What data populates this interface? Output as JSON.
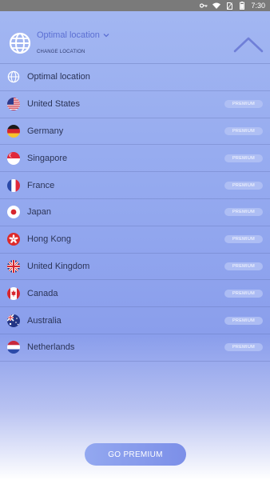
{
  "status_bar": {
    "time": "7:30",
    "icons": [
      "key-icon",
      "wifi-icon",
      "no-sim-icon",
      "battery-icon"
    ]
  },
  "header": {
    "title": "Optimal location",
    "subtitle": "CHANGE LOCATION",
    "icon": "globe-icon",
    "dropdown_icon": "chevron-down-icon",
    "collapse_icon": "chevron-up-icon"
  },
  "locations": [
    {
      "name": "Optimal location",
      "flag": "globe",
      "premium": ""
    },
    {
      "name": "United States",
      "flag": "us",
      "premium": "PREMIUM"
    },
    {
      "name": "Germany",
      "flag": "de",
      "premium": "PREMIUM"
    },
    {
      "name": "Singapore",
      "flag": "sg",
      "premium": "PREMIUM"
    },
    {
      "name": "France",
      "flag": "fr",
      "premium": "PREMIUM"
    },
    {
      "name": "Japan",
      "flag": "jp",
      "premium": "PREMIUM"
    },
    {
      "name": "Hong Kong",
      "flag": "hk",
      "premium": "PREMIUM"
    },
    {
      "name": "United Kingdom",
      "flag": "uk",
      "premium": "PREMIUM"
    },
    {
      "name": "Canada",
      "flag": "ca",
      "premium": "PREMIUM"
    },
    {
      "name": "Australia",
      "flag": "au",
      "premium": "PREMIUM"
    },
    {
      "name": "Netherlands",
      "flag": "nl",
      "premium": "PREMIUM"
    }
  ],
  "go_premium": {
    "label": "GO PREMIUM"
  },
  "colors": {
    "accent": "#5b6fd3",
    "background_top": "#a3b7f2",
    "background_bottom": "#ffffff",
    "badge": "#b4c3f5"
  }
}
